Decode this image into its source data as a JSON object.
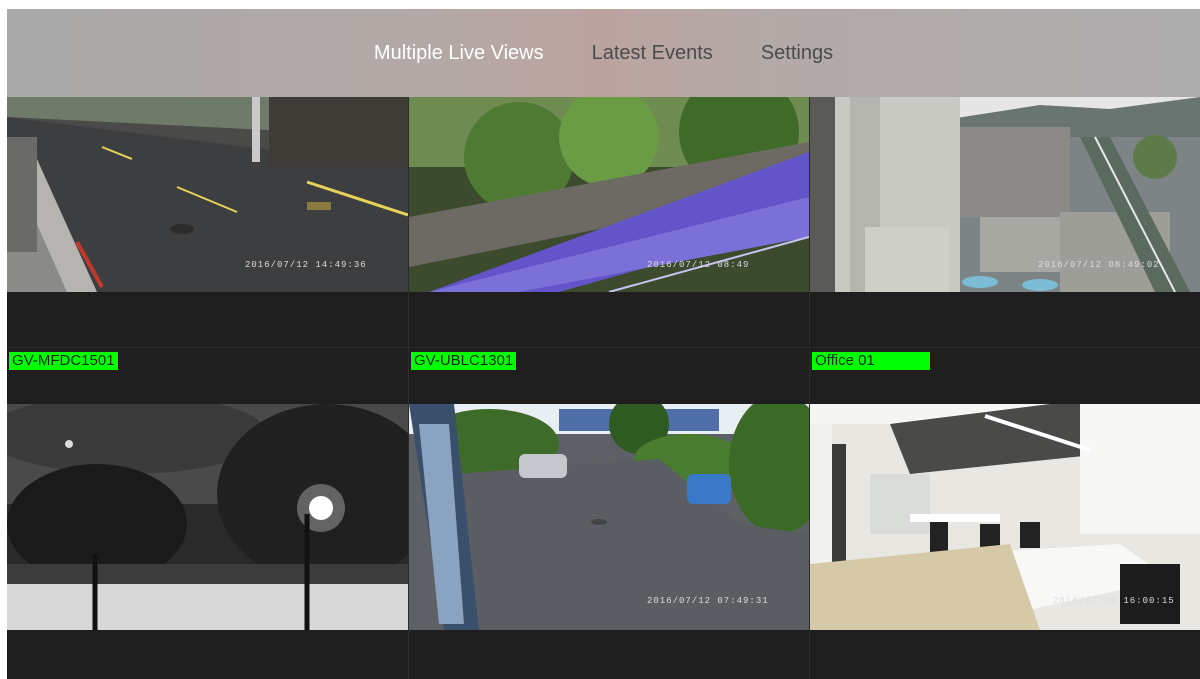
{
  "tabs": [
    {
      "label": "Multiple Live Views",
      "active": true
    },
    {
      "label": "Latest Events",
      "active": false
    },
    {
      "label": "Settings",
      "active": false
    }
  ],
  "cameras": [
    {
      "name": "",
      "timestamp": "2016/07/12   14:49:36"
    },
    {
      "name": "",
      "timestamp": "2016/07/12   08:49"
    },
    {
      "name": "",
      "timestamp": "2016/07/12   08:49:02"
    },
    {
      "name": "GV-MFDC1501",
      "timestamp": ""
    },
    {
      "name": "GV-UBLC1301",
      "timestamp": "2016/07/12   07:49:31"
    },
    {
      "name": "Office 01",
      "timestamp": "2016/07/13   16:00:15"
    }
  ],
  "colors": {
    "label_bg": "#00ff00",
    "active_tab": "#ffffff",
    "inactive_tab": "#4b4b4b"
  }
}
